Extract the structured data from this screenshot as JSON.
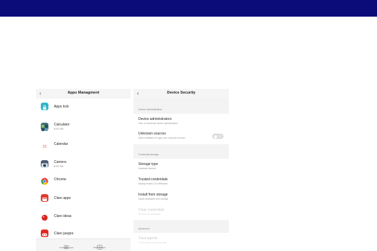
{
  "colors": {
    "topbar": "#0b0b7a",
    "toggle_off": "#e4e4e4"
  },
  "apps_panel": {
    "title": "Apps Managment",
    "back_icon": "chevron-left-icon",
    "apps": [
      {
        "name": "Apps lock",
        "size": "",
        "icon": "apps-lock-icon",
        "color": "#2fb6c9"
      },
      {
        "name": "Calculator",
        "size": "8.00 KB",
        "icon": "calculator-icon",
        "color": "#3f6e7c"
      },
      {
        "name": "Calendar",
        "size": "",
        "icon": "calendar-icon",
        "color": "#ffffff"
      },
      {
        "name": "Camera",
        "size": "8.00 KB",
        "icon": "camera-icon",
        "color": "#4a5b72"
      },
      {
        "name": "Chrome",
        "size": "",
        "icon": "chrome-icon",
        "color": "#e8453c"
      },
      {
        "name": "Claro apps",
        "size": "",
        "icon": "claro-apps-icon",
        "color": "#e03a2f"
      },
      {
        "name": "Claro ideas",
        "size": "",
        "icon": "claro-ideas-icon",
        "color": "#d8261c"
      },
      {
        "name": "Claro juegos",
        "size": "",
        "icon": "claro-juegos-icon",
        "color": "#e02a20"
      }
    ],
    "bottom": {
      "configure": "Configure apps",
      "show_system": "Show system"
    }
  },
  "security_panel": {
    "title": "Device Security",
    "back_icon": "chevron-left-icon",
    "sections": {
      "device_admin": "Device administration",
      "credential_storage": "Credential storage",
      "advanced": "Advanced"
    },
    "items": {
      "device_administrators": {
        "title": "Device administrators",
        "sub": "View or deactivate device administrators"
      },
      "unknown_sources": {
        "title": "Unknown sources",
        "sub": "Allow installation of apps from unknown sources",
        "enabled": false
      },
      "storage_type": {
        "title": "Storage type",
        "sub": "Hardware-backed"
      },
      "trusted_credentials": {
        "title": "Trusted credentials",
        "sub": "Display trusted CA certificates"
      },
      "install_from_storage": {
        "title": "Install from storage",
        "sub": "Install certificates from storage"
      },
      "clear_credentials": {
        "title": "Clear credentials",
        "sub": "Remove all certificates"
      },
      "trust_agents": {
        "title": "Trust agents",
        "sub": "To use, first set a screen lock"
      }
    }
  }
}
